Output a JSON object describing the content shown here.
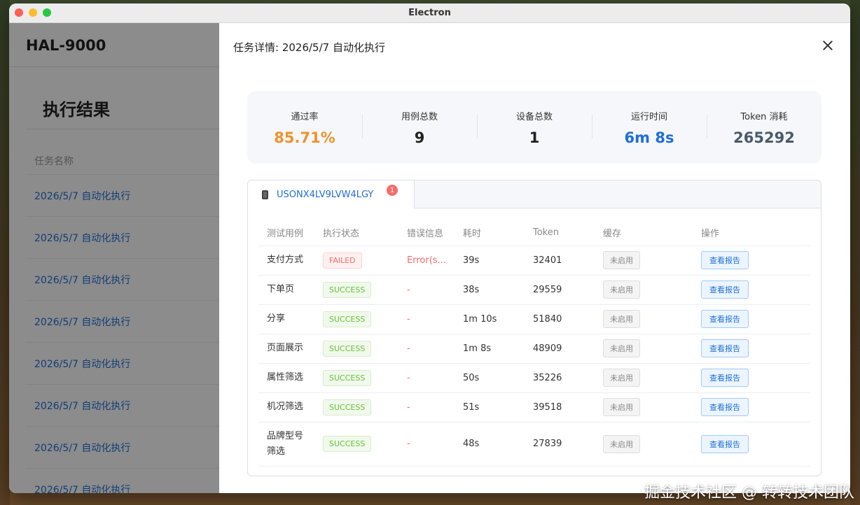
{
  "window": {
    "title": "Electron"
  },
  "app": {
    "name": "HAL-9000",
    "page_title": "执行结果",
    "column_header": "任务名称",
    "tasks": [
      "2026/5/7 自动化执行",
      "2026/5/7 自动化执行",
      "2026/5/7 自动化执行",
      "2026/5/7 自动化执行",
      "2026/5/7 自动化执行",
      "2026/5/7 自动化执行",
      "2026/5/7 自动化执行",
      "2026/5/7 自动化执行"
    ]
  },
  "drawer": {
    "title": "任务详情: 2026/5/7 自动化执行",
    "stats": [
      {
        "label": "通过率",
        "value": "85.71%",
        "color": "#f0932b"
      },
      {
        "label": "用例总数",
        "value": "9",
        "color": "#222222"
      },
      {
        "label": "设备总数",
        "value": "1",
        "color": "#222222"
      },
      {
        "label": "运行时间",
        "value": "6m 8s",
        "color": "#1f6fd6"
      },
      {
        "label": "Token 消耗",
        "value": "265292",
        "color": "#4a5a6a"
      }
    ],
    "device_tab": {
      "label": "USONX4LV9LVW4LGY",
      "badge": "1",
      "icon": "phone-icon"
    },
    "table": {
      "headers": [
        "测试用例",
        "执行状态",
        "错误信息",
        "耗时",
        "Token",
        "缓存",
        "操作"
      ],
      "rows": [
        {
          "case": "支付方式",
          "status": "FAILED",
          "error": "Error(s...",
          "duration": "39s",
          "token": "32401",
          "cache": "未启用",
          "action": "查看报告"
        },
        {
          "case": "下单页",
          "status": "SUCCESS",
          "error": "-",
          "duration": "38s",
          "token": "29559",
          "cache": "未启用",
          "action": "查看报告"
        },
        {
          "case": "分享",
          "status": "SUCCESS",
          "error": "-",
          "duration": "1m 10s",
          "token": "51840",
          "cache": "未启用",
          "action": "查看报告"
        },
        {
          "case": "页面展示",
          "status": "SUCCESS",
          "error": "-",
          "duration": "1m 8s",
          "token": "48909",
          "cache": "未启用",
          "action": "查看报告"
        },
        {
          "case": "属性筛选",
          "status": "SUCCESS",
          "error": "-",
          "duration": "50s",
          "token": "35226",
          "cache": "未启用",
          "action": "查看报告"
        },
        {
          "case": "机况筛选",
          "status": "SUCCESS",
          "error": "-",
          "duration": "51s",
          "token": "39518",
          "cache": "未启用",
          "action": "查看报告"
        },
        {
          "case": "品牌型号筛选",
          "status": "SUCCESS",
          "error": "-",
          "duration": "48s",
          "token": "27839",
          "cache": "未启用",
          "action": "查看报告"
        }
      ]
    }
  },
  "watermark": "掘金技术社区 @ 转转技术团队"
}
